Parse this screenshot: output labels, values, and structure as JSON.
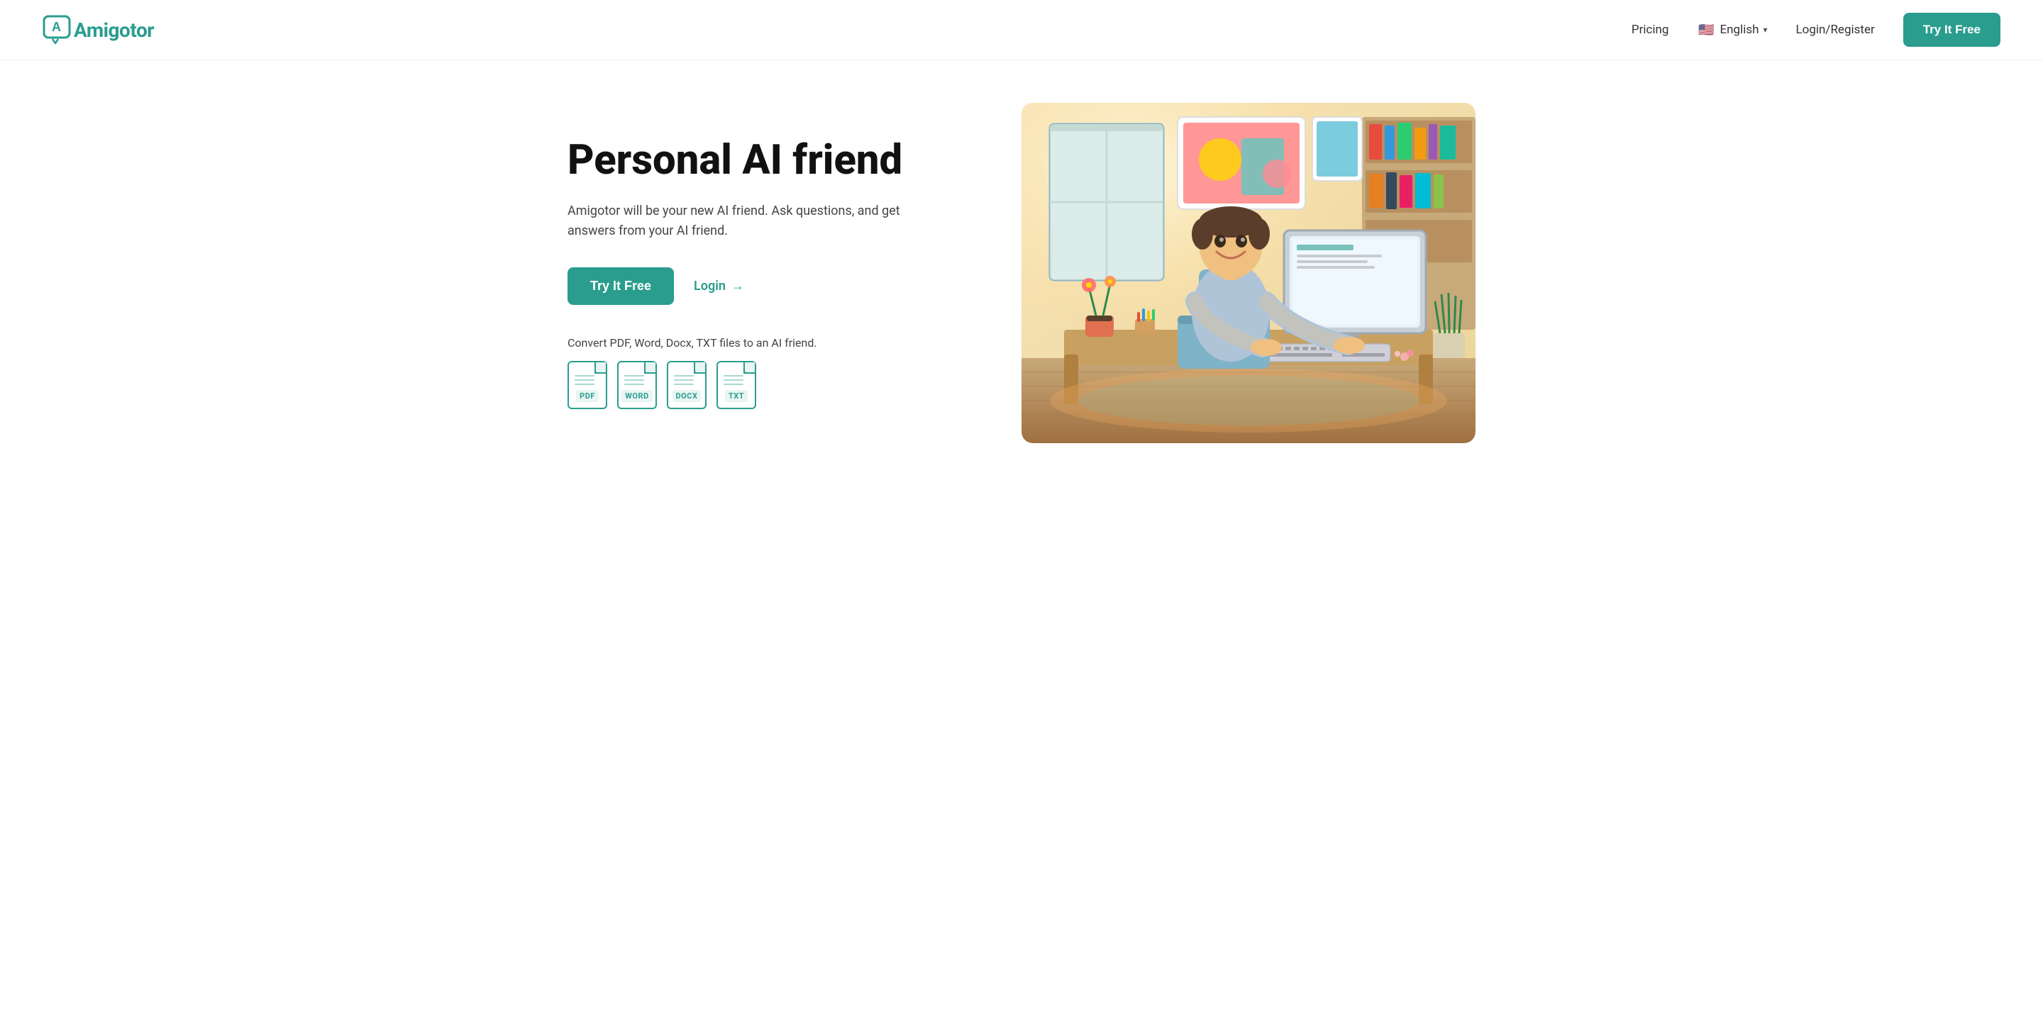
{
  "brand": {
    "name": "Amigotor",
    "logo_letter": "A"
  },
  "navbar": {
    "pricing_label": "Pricing",
    "language_label": "English",
    "language_flag": "🇺🇸",
    "login_register_label": "Login/Register",
    "try_free_label": "Try It Free"
  },
  "hero": {
    "title": "Personal AI friend",
    "subtitle": "Amigotor will be your new AI friend. Ask questions, and get answers from your AI friend.",
    "try_free_label": "Try It Free",
    "login_label": "Login",
    "convert_label": "Convert PDF, Word, Docx, TXT files to an AI friend.",
    "file_types": [
      "PDF",
      "WORD",
      "DOCX",
      "TXT"
    ]
  }
}
